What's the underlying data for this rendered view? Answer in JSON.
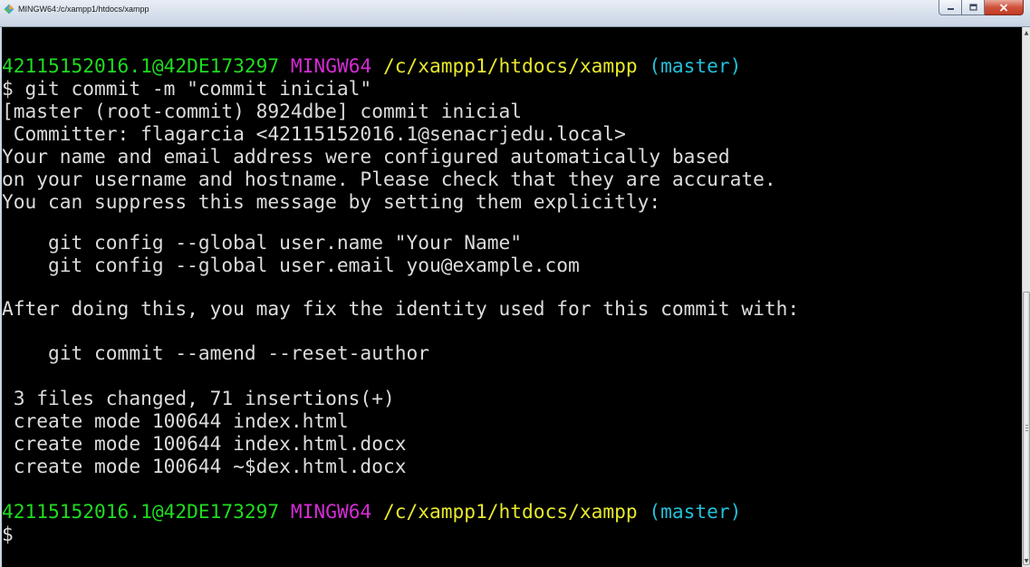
{
  "window": {
    "title": "MINGW64:/c/xampp1/htdocs/xampp",
    "buttons": {
      "minimize": "minimize",
      "maximize": "maximize",
      "close": "close"
    }
  },
  "prompt": {
    "user_host": "42115152016.1@42DE173297",
    "system": "MINGW64",
    "path": "/c/xampp1/htdocs/xampp",
    "branch": "(master)",
    "symbol": "$"
  },
  "output": {
    "command": "$ git commit -m \"commit inicial\"",
    "lines": [
      "[master (root-commit) 8924dbe] commit inicial",
      " Committer: flagarcia <42115152016.1@senacrjedu.local>",
      "Your name and email address were configured automatically based",
      "on your username and hostname. Please check that they are accurate.",
      "You can suppress this message by setting them explicitly:",
      "",
      "    git config --global user.name \"Your Name\"",
      "    git config --global user.email you@example.com",
      "",
      "After doing this, you may fix the identity used for this commit with:",
      "",
      "    git commit --amend --reset-author",
      "",
      " 3 files changed, 71 insertions(+)",
      " create mode 100644 index.html",
      " create mode 100644 index.html.docx",
      " create mode 100644 ~$dex.html.docx"
    ]
  },
  "colors": {
    "user_host": "#1fdc1f",
    "system": "#d42cd6",
    "path": "#e8e82c",
    "branch": "#22c0d8",
    "text": "#dcdcdc",
    "background": "#000000"
  }
}
